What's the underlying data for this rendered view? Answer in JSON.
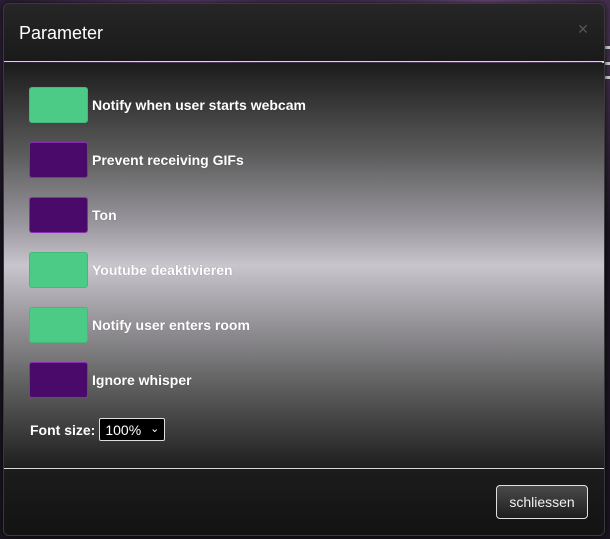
{
  "dialog": {
    "title": "Parameter",
    "close_icon": "close-icon"
  },
  "options": [
    {
      "label": "Notify when user starts webcam",
      "state": "on"
    },
    {
      "label": "Prevent receiving GIFs",
      "state": "off"
    },
    {
      "label": "Ton",
      "state": "off"
    },
    {
      "label": "Youtube deaktivieren",
      "state": "on"
    },
    {
      "label": "Notify user enters room",
      "state": "on"
    },
    {
      "label": "Ignore whisper",
      "state": "off"
    }
  ],
  "font_size": {
    "label": "Font size:",
    "value": "100%"
  },
  "footer": {
    "close_label": "schliessen"
  },
  "colors": {
    "toggle_on": "#4ccb86",
    "toggle_off": "#4a0a6a"
  }
}
